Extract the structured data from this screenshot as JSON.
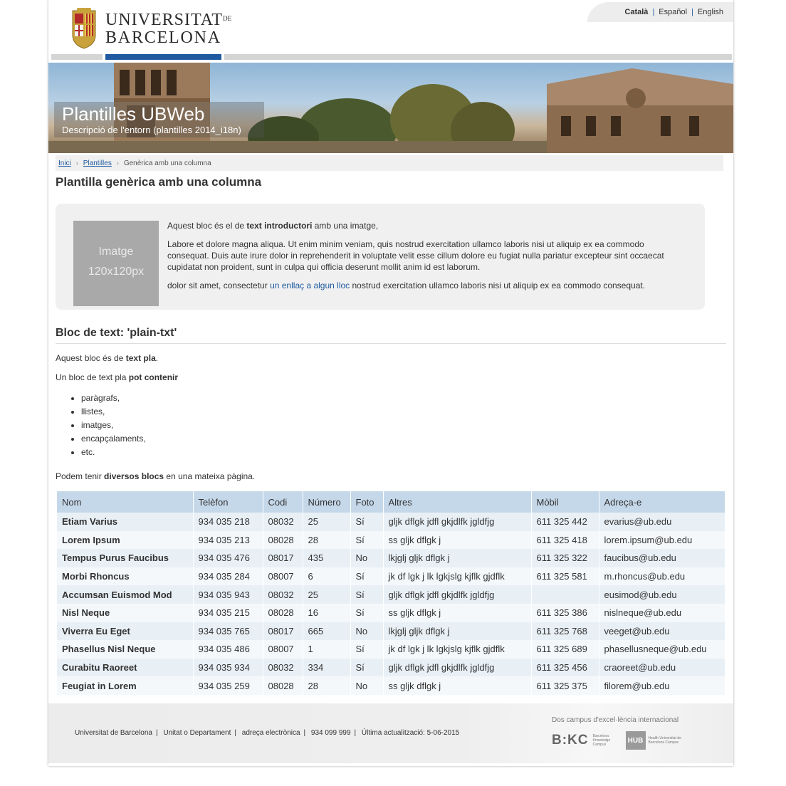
{
  "header": {
    "logo_top": "UNIVERSITAT",
    "logo_de": "DE",
    "logo_bottom": "BARCELONA",
    "languages": [
      {
        "label": "Català"
      },
      {
        "label": "Español"
      },
      {
        "label": "English"
      }
    ]
  },
  "banner": {
    "title": "Plantilles UBWeb",
    "subtitle": "Descripció de l'entorn (plantilles 2014_i18n)"
  },
  "breadcrumb": {
    "items": [
      "Inici",
      "Plantilles"
    ],
    "current": "Genèrica amb una columna"
  },
  "page": {
    "title": "Plantilla genèrica amb una columna"
  },
  "intro": {
    "image_placeholder_line1": "Imatge",
    "image_placeholder_line2": "120x120px",
    "p1_pre": "Aquest bloc és el de ",
    "p1_bold": "text introductori",
    "p1_post": " amb una imatge,",
    "p2": "Labore et dolore magna aliqua. Ut enim minim veniam, quis nostrud exercitation ullamco laboris nisi ut aliquip ex ea commodo consequat. Duis aute irure dolor in reprehenderit in voluptate velit esse cillum dolore eu fugiat nulla pariatur excepteur sint occaecat cupidatat non proident, sunt in culpa qui officia deserunt mollit anim id est laborum.",
    "p3_pre": "dolor sit amet, consectetur ",
    "p3_link": "un enllaç a algun lloc",
    "p3_post": " nostrud exercitation ullamco laboris nisi ut aliquip ex ea commodo consequat."
  },
  "plain": {
    "heading": "Bloc de text: 'plain-txt'",
    "p1_pre": "Aquest bloc és de ",
    "p1_bold": "text pla",
    "p1_post": ".",
    "p2_pre": "Un bloc de text pla ",
    "p2_bold": "pot contenir",
    "list": [
      "paràgrafs,",
      "llistes,",
      "imatges,",
      "encapçalaments,",
      "etc."
    ],
    "p3_pre": "Podem tenir ",
    "p3_bold": "diversos blocs",
    "p3_post": " en una mateixa pàgina."
  },
  "table": {
    "headers": [
      "Nom",
      "Telèfon",
      "Codi",
      "Número",
      "Foto",
      "Altres",
      "Mòbil",
      "Adreça-e"
    ],
    "rows": [
      [
        "Etiam Varius",
        "934 035 218",
        "08032",
        "25",
        "Sí",
        "gljk dflgk jdfl gkjdlfk jgldfjg",
        "611 325 442",
        "evarius@ub.edu"
      ],
      [
        "Lorem Ipsum",
        "934 035 213",
        "08028",
        "28",
        "Sí",
        "ss gljk dflgk j",
        "611 325 418",
        "lorem.ipsum@ub.edu"
      ],
      [
        "Tempus Purus Faucibus",
        "934 035 476",
        "08017",
        "435",
        "No",
        "lkjglj gljk dflgk j",
        "611 325 322",
        "faucibus@ub.edu"
      ],
      [
        "Morbi Rhoncus",
        "934 035 284",
        "08007",
        "6",
        "Sí",
        "jk df lgk j lk lgkjslg kjflk gjdflk",
        "611 325 581",
        "m.rhoncus@ub.edu"
      ],
      [
        "Accumsan Euismod Mod",
        "934 035 943",
        "08032",
        "25",
        "Sí",
        "gljk dflgk jdfl gkjdlfk jgldfjg",
        "",
        "eusimod@ub.edu"
      ],
      [
        "Nisl Neque",
        "934 035 215",
        "08028",
        "16",
        "Sí",
        "ss gljk dflgk j",
        "611 325 386",
        "nislneque@ub.edu"
      ],
      [
        "Viverra Eu Eget",
        "934 035 765",
        "08017",
        "665",
        "No",
        "lkjglj gljk dflgk j",
        "611 325 768",
        "veeget@ub.edu"
      ],
      [
        "Phasellus Nisl Neque",
        "934 035 486",
        "08007",
        "1",
        "Sí",
        "jk df lgk j lk lgkjslg kjflk gjdflk",
        "611 325 689",
        "phasellusneque@ub.edu"
      ],
      [
        "Curabitu Raoreet",
        "934 035 934",
        "08032",
        "334",
        "Sí",
        "gljk dflgk jdfl gkjdlfk jgldfjg",
        "611 325 456",
        "craoreet@ub.edu"
      ],
      [
        "Feugiat in Lorem",
        "934 035 259",
        "08028",
        "28",
        "No",
        "ss gljk dflgk j",
        "611 325 375",
        "filorem@ub.edu"
      ]
    ]
  },
  "footer": {
    "items": [
      "Universitat de Barcelona",
      "Unitat o Departament",
      "adreça electrònica",
      "934 099 999",
      "Última actualització: 5-06-2015"
    ],
    "tagline": "Dos campus d'excel·lència internacional",
    "bkc": "B:KC",
    "bkc_small": "Barcelona Knowledge Campus",
    "hub": "HUB",
    "hub_small": "Health Universitat de Barcelona Campus"
  }
}
